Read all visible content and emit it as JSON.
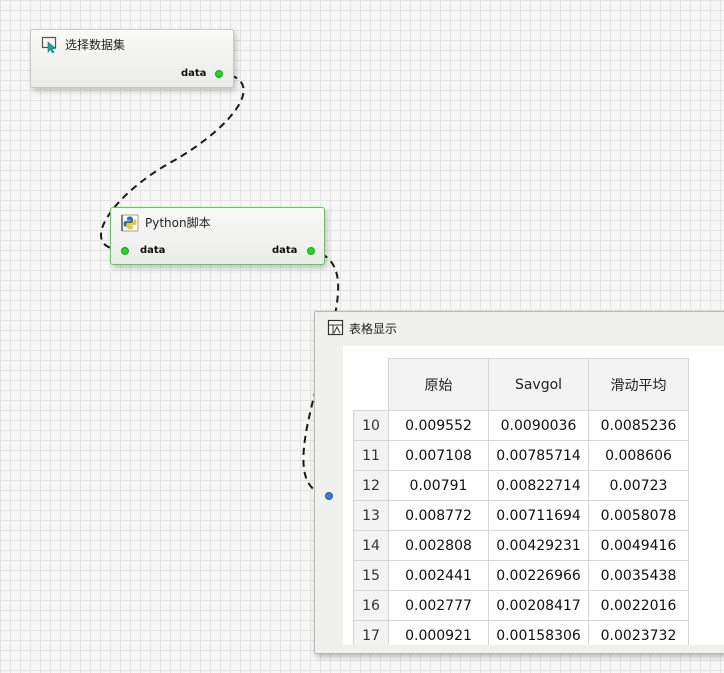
{
  "nodes": {
    "dataset": {
      "title": "选择数据集",
      "output_port": "data"
    },
    "python": {
      "title": "Python脚本",
      "input_port": "data",
      "output_port": "data"
    },
    "table": {
      "title": "表格显示",
      "columns": [
        "原始",
        "Savgol",
        "滑动平均"
      ],
      "rows": [
        {
          "index": "10",
          "values": [
            "0.009552",
            "0.0090036",
            "0.0085236"
          ]
        },
        {
          "index": "11",
          "values": [
            "0.007108",
            "0.00785714",
            "0.008606"
          ]
        },
        {
          "index": "12",
          "values": [
            "0.00791",
            "0.00822714",
            "0.00723"
          ]
        },
        {
          "index": "13",
          "values": [
            "0.008772",
            "0.00711694",
            "0.0058078"
          ]
        },
        {
          "index": "14",
          "values": [
            "0.002808",
            "0.00429231",
            "0.0049416"
          ]
        },
        {
          "index": "15",
          "values": [
            "0.002441",
            "0.00226966",
            "0.0035438"
          ]
        },
        {
          "index": "16",
          "values": [
            "0.002777",
            "0.00208417",
            "0.0022016"
          ]
        },
        {
          "index": "17",
          "values": [
            "0.000921",
            "0.00158306",
            "0.0023732"
          ]
        }
      ]
    }
  },
  "icons": {
    "dataset": "cursor-select-icon",
    "python": "python-icon",
    "table": "table-display-icon"
  },
  "colors": {
    "grid_background": "#f7f7f7",
    "selected_border": "#45d945",
    "output_port": "#1fd81f",
    "input_port_table": "#3a7bd5",
    "wire": "#1a1a1a"
  }
}
